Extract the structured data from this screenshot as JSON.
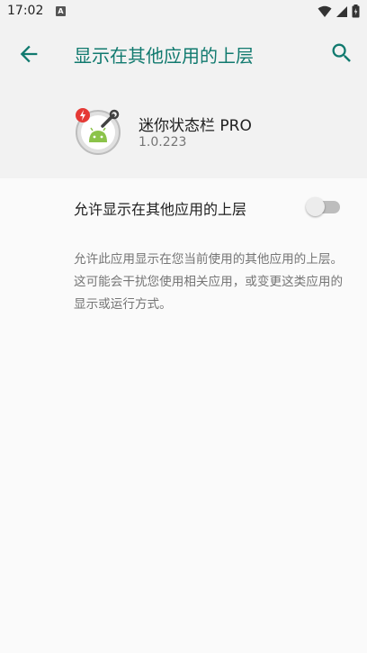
{
  "status_bar": {
    "time": "17:02",
    "notification_glyph": "A",
    "icons": [
      "wifi-icon",
      "signal-icon",
      "battery-icon"
    ]
  },
  "app_bar": {
    "title": "显示在其他应用的上层",
    "back_icon": "arrow-back-icon",
    "search_icon": "search-icon"
  },
  "app": {
    "name": "迷你状态栏 PRO",
    "version": "1.0.223"
  },
  "setting": {
    "label": "允许显示在其他应用的上层",
    "enabled": false
  },
  "description": "允许此应用显示在您当前使用的其他应用的上层。这可能会干扰您使用相关应用，或变更这类应用的显示或运行方式。",
  "colors": {
    "accent": "#117a6f",
    "background": "#fafafa",
    "header_background": "#f2f2f2",
    "badge_red": "#e53935",
    "android_green": "#8bc34a"
  }
}
